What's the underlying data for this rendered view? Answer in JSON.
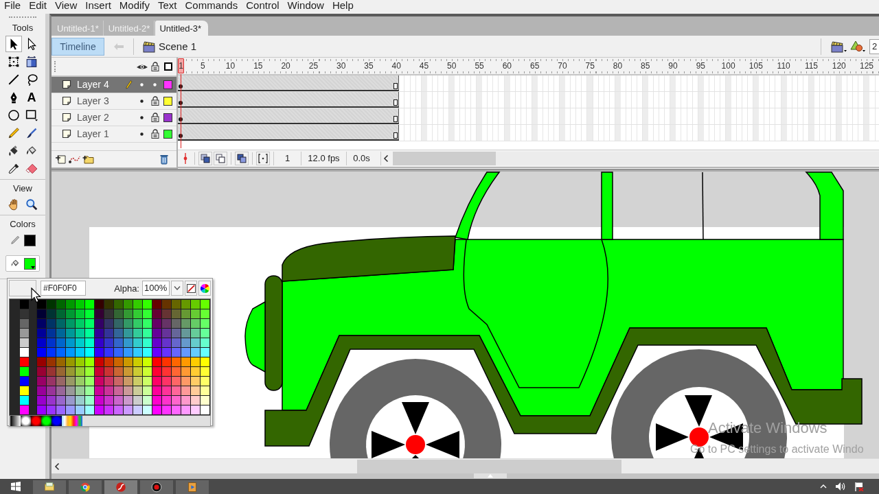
{
  "menu_bar": {
    "items": [
      "File",
      "Edit",
      "View",
      "Insert",
      "Modify",
      "Text",
      "Commands",
      "Control",
      "Window",
      "Help"
    ]
  },
  "tools_panel": {
    "title": "Tools",
    "tools": [
      {
        "kind": "selection",
        "selected": true
      },
      {
        "kind": "subselection",
        "selected": false
      },
      {
        "kind": "free-transform",
        "selected": false
      },
      {
        "kind": "gradient-transform",
        "selected": false
      },
      {
        "kind": "line",
        "selected": false
      },
      {
        "kind": "lasso",
        "selected": false
      },
      {
        "kind": "pen",
        "selected": false
      },
      {
        "kind": "text",
        "glyph": "A",
        "selected": false
      },
      {
        "kind": "oval",
        "selected": false
      },
      {
        "kind": "rectangle",
        "selected": false
      },
      {
        "kind": "pencil",
        "selected": false
      },
      {
        "kind": "brush",
        "selected": false
      },
      {
        "kind": "ink-bottle",
        "selected": false
      },
      {
        "kind": "paint-bucket",
        "selected": false
      },
      {
        "kind": "eyedropper",
        "selected": false
      },
      {
        "kind": "eraser",
        "selected": false
      }
    ],
    "view_title": "View",
    "view_tools": [
      {
        "kind": "hand",
        "selected": false
      },
      {
        "kind": "zoom",
        "selected": false
      }
    ],
    "colors_title": "Colors",
    "stroke_color": {
      "color": "#000000",
      "selected": false
    },
    "fill_color": {
      "color": "#00ff00",
      "selected": true
    }
  },
  "document_tabs": [
    {
      "label": "Untitled-1*",
      "selected": false
    },
    {
      "label": "Untitled-2*",
      "selected": false
    },
    {
      "label": "Untitled-3*",
      "selected": true
    }
  ],
  "edit_bar": {
    "timeline_button": {
      "label": "Timeline",
      "on": true
    },
    "back_button": {
      "disabled": true
    },
    "scene": "Scene 1",
    "zoom_value": "2"
  },
  "timeline": {
    "ruler": [
      "5",
      "10",
      "15",
      "20",
      "25",
      "30",
      "35",
      "40",
      "45",
      "50",
      "55",
      "60",
      "65",
      "70",
      "75",
      "80",
      "85",
      "90",
      "95",
      "100",
      "105",
      "110",
      "115",
      "120",
      "125"
    ],
    "layers": [
      {
        "name": "Layer 4",
        "selected": true,
        "visible": true,
        "locked": false,
        "color": "#ff33ff",
        "level": 0.315
      },
      {
        "name": "Layer 3",
        "selected": false,
        "visible": true,
        "locked": true,
        "color": "#ffff33",
        "level": 0.315
      },
      {
        "name": "Layer 2",
        "selected": false,
        "visible": true,
        "locked": true,
        "color": "#9933cc",
        "level": 0.315
      },
      {
        "name": "Layer 1",
        "selected": false,
        "visible": true,
        "locked": true,
        "color": "#33ff33",
        "level": 0.315
      }
    ],
    "playhead": {
      "label": "1",
      "level": 0
    },
    "current_frame": "1",
    "frame_rate": "12.0 fps",
    "elapsed_time": "0.0s"
  },
  "color_picker": {
    "preview": {
      "color": "#f0f0f0"
    },
    "hex_value": "#F0F0F0",
    "alpha_label": "Alpha:",
    "alpha_value": "100%",
    "base_colors": [
      {
        "color": "#000000"
      },
      {
        "color": "#333333"
      },
      {
        "color": "#666666"
      },
      {
        "color": "#999999"
      },
      {
        "color": "#cccccc"
      },
      {
        "color": "#ffffff"
      },
      {
        "color": "#ff0000"
      },
      {
        "color": "#00ff00"
      },
      {
        "color": "#0000ff"
      },
      {
        "color": "#ffff00"
      },
      {
        "color": "#00ffff"
      },
      {
        "color": "#ff00ff"
      }
    ],
    "grid_rows": [
      [
        {
          "color": "#000000"
        },
        {
          "color": "#003300"
        },
        {
          "color": "#006600"
        },
        {
          "color": "#009900"
        },
        {
          "color": "#00cc00"
        },
        {
          "color": "#00ff00"
        },
        {
          "color": "#330000"
        },
        {
          "color": "#333300"
        },
        {
          "color": "#336600"
        },
        {
          "color": "#339900"
        },
        {
          "color": "#33cc00"
        },
        {
          "color": "#33ff00"
        },
        {
          "color": "#660000"
        },
        {
          "color": "#663300"
        },
        {
          "color": "#666600"
        },
        {
          "color": "#669900"
        },
        {
          "color": "#66cc00"
        },
        {
          "color": "#66ff00"
        }
      ],
      [
        {
          "color": "#000033"
        },
        {
          "color": "#003333"
        },
        {
          "color": "#006633"
        },
        {
          "color": "#009933"
        },
        {
          "color": "#00cc33"
        },
        {
          "color": "#00ff33"
        },
        {
          "color": "#330033"
        },
        {
          "color": "#333333"
        },
        {
          "color": "#336633"
        },
        {
          "color": "#339933"
        },
        {
          "color": "#33cc33"
        },
        {
          "color": "#33ff33"
        },
        {
          "color": "#660033"
        },
        {
          "color": "#663333"
        },
        {
          "color": "#666633"
        },
        {
          "color": "#669933"
        },
        {
          "color": "#66cc33"
        },
        {
          "color": "#66ff33"
        }
      ],
      [
        {
          "color": "#000066"
        },
        {
          "color": "#003366"
        },
        {
          "color": "#006666"
        },
        {
          "color": "#009966"
        },
        {
          "color": "#00cc66"
        },
        {
          "color": "#00ff66"
        },
        {
          "color": "#330066"
        },
        {
          "color": "#333366"
        },
        {
          "color": "#336666"
        },
        {
          "color": "#339966"
        },
        {
          "color": "#33cc66"
        },
        {
          "color": "#33ff66"
        },
        {
          "color": "#660066"
        },
        {
          "color": "#663366"
        },
        {
          "color": "#666666"
        },
        {
          "color": "#669966"
        },
        {
          "color": "#66cc66"
        },
        {
          "color": "#66ff66"
        }
      ],
      [
        {
          "color": "#000099"
        },
        {
          "color": "#003399"
        },
        {
          "color": "#006699"
        },
        {
          "color": "#009999"
        },
        {
          "color": "#00cc99"
        },
        {
          "color": "#00ff99"
        },
        {
          "color": "#330099"
        },
        {
          "color": "#333399"
        },
        {
          "color": "#336699"
        },
        {
          "color": "#339999"
        },
        {
          "color": "#33cc99"
        },
        {
          "color": "#33ff99"
        },
        {
          "color": "#660099"
        },
        {
          "color": "#663399"
        },
        {
          "color": "#666699"
        },
        {
          "color": "#669999"
        },
        {
          "color": "#66cc99"
        },
        {
          "color": "#66ff99"
        }
      ],
      [
        {
          "color": "#0000cc"
        },
        {
          "color": "#0033cc"
        },
        {
          "color": "#0066cc"
        },
        {
          "color": "#0099cc"
        },
        {
          "color": "#00cccc"
        },
        {
          "color": "#00ffcc"
        },
        {
          "color": "#3300cc"
        },
        {
          "color": "#3333cc"
        },
        {
          "color": "#3366cc"
        },
        {
          "color": "#3399cc"
        },
        {
          "color": "#33cccc"
        },
        {
          "color": "#33ffcc"
        },
        {
          "color": "#6600cc"
        },
        {
          "color": "#6633cc"
        },
        {
          "color": "#6666cc"
        },
        {
          "color": "#6699cc"
        },
        {
          "color": "#66cccc"
        },
        {
          "color": "#66ffcc"
        }
      ],
      [
        {
          "color": "#0000ff"
        },
        {
          "color": "#0033ff"
        },
        {
          "color": "#0066ff"
        },
        {
          "color": "#0099ff"
        },
        {
          "color": "#00ccff"
        },
        {
          "color": "#00ffff"
        },
        {
          "color": "#3300ff"
        },
        {
          "color": "#3333ff"
        },
        {
          "color": "#3366ff"
        },
        {
          "color": "#3399ff"
        },
        {
          "color": "#33ccff"
        },
        {
          "color": "#33ffff"
        },
        {
          "color": "#6600ff"
        },
        {
          "color": "#6633ff"
        },
        {
          "color": "#6666ff"
        },
        {
          "color": "#6699ff"
        },
        {
          "color": "#66ccff"
        },
        {
          "color": "#66ffff"
        }
      ],
      [
        {
          "color": "#990000"
        },
        {
          "color": "#993300"
        },
        {
          "color": "#996600"
        },
        {
          "color": "#999900"
        },
        {
          "color": "#99cc00"
        },
        {
          "color": "#99ff00"
        },
        {
          "color": "#cc0000"
        },
        {
          "color": "#cc3300"
        },
        {
          "color": "#cc6600"
        },
        {
          "color": "#cc9900"
        },
        {
          "color": "#cccc00"
        },
        {
          "color": "#ccff00"
        },
        {
          "color": "#ff0000"
        },
        {
          "color": "#ff3300"
        },
        {
          "color": "#ff6600"
        },
        {
          "color": "#ff9900"
        },
        {
          "color": "#ffcc00"
        },
        {
          "color": "#ffff00"
        }
      ],
      [
        {
          "color": "#990033"
        },
        {
          "color": "#993333"
        },
        {
          "color": "#996633"
        },
        {
          "color": "#999933"
        },
        {
          "color": "#99cc33"
        },
        {
          "color": "#99ff33"
        },
        {
          "color": "#cc0033"
        },
        {
          "color": "#cc3333"
        },
        {
          "color": "#cc6633"
        },
        {
          "color": "#cc9933"
        },
        {
          "color": "#cccc33"
        },
        {
          "color": "#ccff33"
        },
        {
          "color": "#ff0033"
        },
        {
          "color": "#ff3333"
        },
        {
          "color": "#ff6633"
        },
        {
          "color": "#ff9933"
        },
        {
          "color": "#ffcc33"
        },
        {
          "color": "#ffff33"
        }
      ],
      [
        {
          "color": "#990066"
        },
        {
          "color": "#993366"
        },
        {
          "color": "#996666"
        },
        {
          "color": "#999966"
        },
        {
          "color": "#99cc66"
        },
        {
          "color": "#99ff66"
        },
        {
          "color": "#cc0066"
        },
        {
          "color": "#cc3366"
        },
        {
          "color": "#cc6666"
        },
        {
          "color": "#cc9966"
        },
        {
          "color": "#cccc66"
        },
        {
          "color": "#ccff66"
        },
        {
          "color": "#ff0066"
        },
        {
          "color": "#ff3366"
        },
        {
          "color": "#ff6666"
        },
        {
          "color": "#ff9966"
        },
        {
          "color": "#ffcc66"
        },
        {
          "color": "#ffff66"
        }
      ],
      [
        {
          "color": "#990099"
        },
        {
          "color": "#993399"
        },
        {
          "color": "#996699"
        },
        {
          "color": "#999999"
        },
        {
          "color": "#99cc99"
        },
        {
          "color": "#99ff99"
        },
        {
          "color": "#cc0099"
        },
        {
          "color": "#cc3399"
        },
        {
          "color": "#cc6699"
        },
        {
          "color": "#cc9999"
        },
        {
          "color": "#cccc99"
        },
        {
          "color": "#ccff99"
        },
        {
          "color": "#ff0099"
        },
        {
          "color": "#ff3399"
        },
        {
          "color": "#ff6699"
        },
        {
          "color": "#ff9999"
        },
        {
          "color": "#ffcc99"
        },
        {
          "color": "#ffff99"
        }
      ],
      [
        {
          "color": "#9900cc"
        },
        {
          "color": "#9933cc"
        },
        {
          "color": "#9966cc"
        },
        {
          "color": "#9999cc"
        },
        {
          "color": "#99cccc"
        },
        {
          "color": "#99ffcc"
        },
        {
          "color": "#cc00cc"
        },
        {
          "color": "#cc33cc"
        },
        {
          "color": "#cc66cc"
        },
        {
          "color": "#cc99cc"
        },
        {
          "color": "#cccccc"
        },
        {
          "color": "#ccffcc"
        },
        {
          "color": "#ff00cc"
        },
        {
          "color": "#ff33cc"
        },
        {
          "color": "#ff66cc"
        },
        {
          "color": "#ff99cc"
        },
        {
          "color": "#ffcccc"
        },
        {
          "color": "#ffffcc"
        }
      ],
      [
        {
          "color": "#9900ff"
        },
        {
          "color": "#9933ff"
        },
        {
          "color": "#9966ff"
        },
        {
          "color": "#9999ff"
        },
        {
          "color": "#99ccff"
        },
        {
          "color": "#99ffff"
        },
        {
          "color": "#cc00ff"
        },
        {
          "color": "#cc33ff"
        },
        {
          "color": "#cc66ff"
        },
        {
          "color": "#cc99ff"
        },
        {
          "color": "#ccccff"
        },
        {
          "color": "#ccffff"
        },
        {
          "color": "#ff00ff"
        },
        {
          "color": "#ff33ff"
        },
        {
          "color": "#ff66ff"
        },
        {
          "color": "#ff99ff"
        },
        {
          "color": "#ffccff"
        },
        {
          "color": "#ffffff"
        }
      ]
    ],
    "gradients": [
      {
        "kind": "linear"
      },
      {
        "kind": "radial",
        "color": "#ffffff"
      },
      {
        "kind": "radial",
        "color": "#ff0000"
      },
      {
        "kind": "radial",
        "color": "#00ff00"
      },
      {
        "kind": "radial",
        "color": "#0000ff"
      },
      {
        "kind": "rainbow"
      }
    ]
  },
  "os_notice": {
    "title": "Activate Windows",
    "message": "Go to PC settings to activate Windo"
  },
  "taskbar": {
    "apps": [
      {
        "kind": "folder",
        "selected": false
      },
      {
        "kind": "browser",
        "selected": false
      },
      {
        "kind": "animator",
        "selected": true
      },
      {
        "kind": "recorder",
        "selected": false
      },
      {
        "kind": "media",
        "selected": false
      }
    ]
  }
}
